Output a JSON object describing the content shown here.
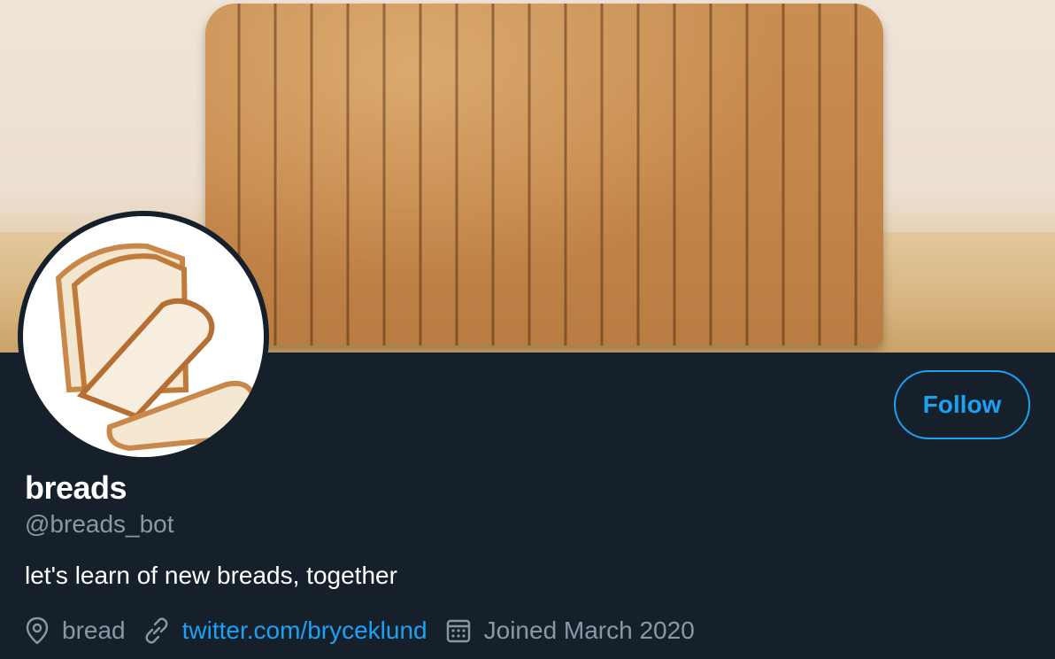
{
  "profile": {
    "name": "breads",
    "handle": "@breads_bot",
    "bio": "let's learn of new breads, together",
    "location": "bread",
    "website": "twitter.com/bryceklund",
    "joined": "Joined March 2020"
  },
  "actions": {
    "follow_label": "Follow"
  },
  "colors": {
    "background": "#15202b",
    "accent": "#1da1f2",
    "secondary_text": "#8899a6",
    "primary_text": "#ffffff"
  },
  "icons": {
    "location": "location-pin-icon",
    "website": "link-icon",
    "joined": "calendar-icon"
  }
}
